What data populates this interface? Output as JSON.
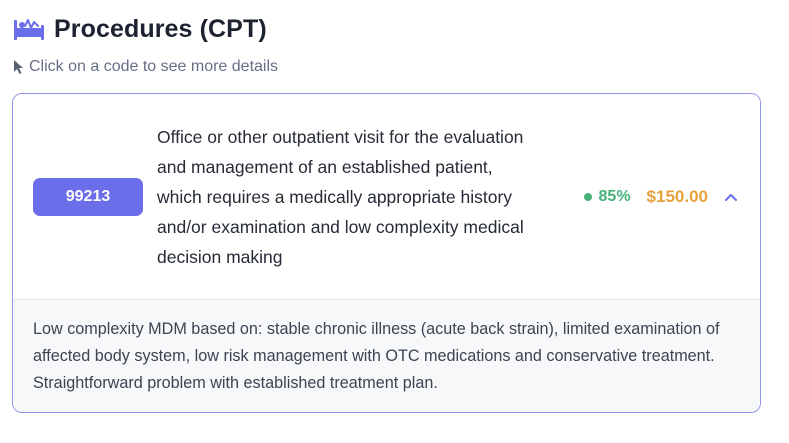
{
  "header": {
    "title": "Procedures (CPT)",
    "icon": "procedure-bed-icon",
    "icon_color": "#6a6ee8"
  },
  "hint": {
    "text": "Click on a code to see more details",
    "icon": "cursor-pointer-icon"
  },
  "procedure": {
    "code": "99213",
    "description": "Office or other outpatient visit for the evaluation and management of an established patient, which requires a medically appropriate history and/or examination and low complexity medical decision making",
    "confidence": "85%",
    "price": "$150.00",
    "expanded": true,
    "details": "Low complexity MDM based on: stable chronic illness (acute back strain), limited examination of affected body system, low risk management with OTC medications and conservative treatment. Straightforward problem with established treatment plan."
  },
  "colors": {
    "accent": "#6a6ee8",
    "card_border": "#8f95e8",
    "confidence_green": "#45b27a",
    "price_orange": "#e6a23c"
  }
}
